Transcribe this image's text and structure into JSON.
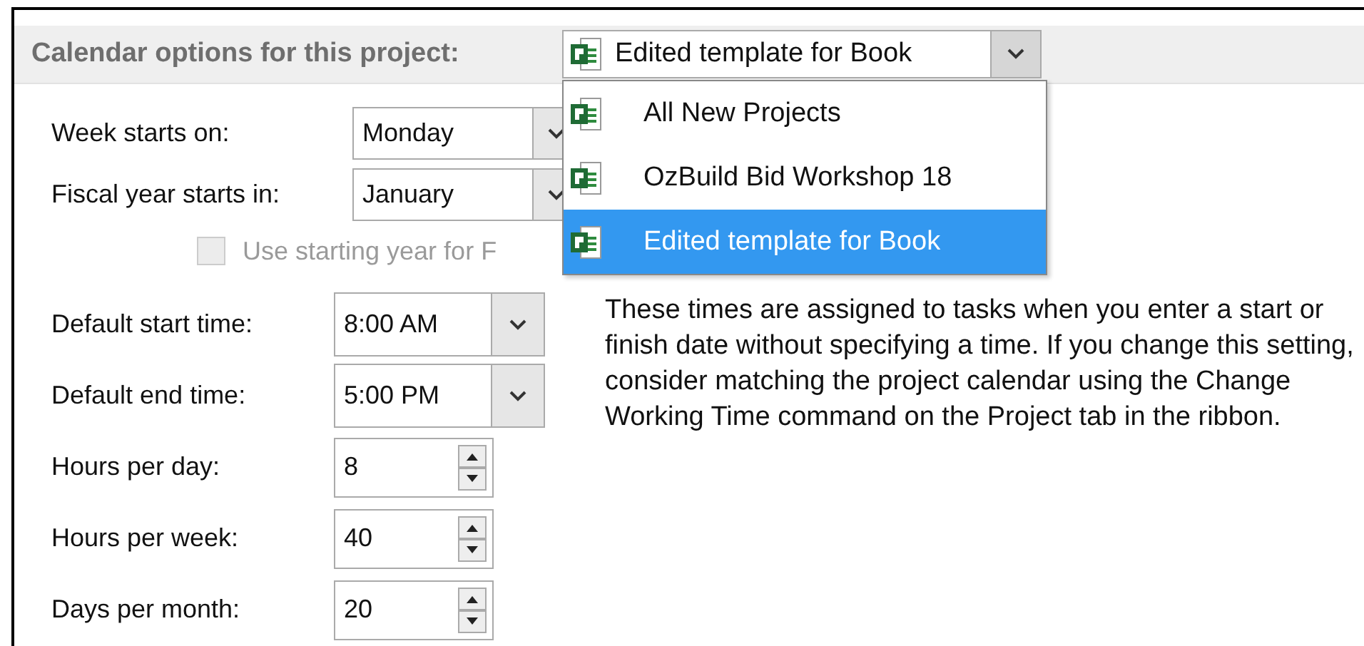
{
  "header": {
    "label": "Calendar options for this project:",
    "combo": {
      "value": "Edited template for Book",
      "expanded": true
    }
  },
  "dropdown_options": [
    {
      "label": "All New Projects",
      "selected": false
    },
    {
      "label": "OzBuild Bid Workshop 18",
      "selected": false
    },
    {
      "label": "Edited template for Book",
      "selected": true
    }
  ],
  "week_starts_on": {
    "label": "Week starts on:",
    "value": "Monday"
  },
  "fiscal_year_starts_in": {
    "label": "Fiscal year starts in:",
    "value": "January"
  },
  "use_starting_year": {
    "label": "Use starting year for F",
    "checked": false,
    "disabled": true
  },
  "time_fields": [
    {
      "kind": "combo",
      "label": "Default start time:",
      "value": "8:00 AM"
    },
    {
      "kind": "combo",
      "label": "Default end time:",
      "value": "5:00 PM"
    },
    {
      "kind": "spinner",
      "label": "Hours per day:",
      "value": "8"
    },
    {
      "kind": "spinner",
      "label": "Hours per week:",
      "value": "40"
    },
    {
      "kind": "spinner",
      "label": "Days per month:",
      "value": "20"
    }
  ],
  "note": "These times are assigned to tasks when you enter a start or finish date without specifying a time. If you change this setting, consider matching the project calendar using the Change Working Time command on the Project tab in the ribbon."
}
